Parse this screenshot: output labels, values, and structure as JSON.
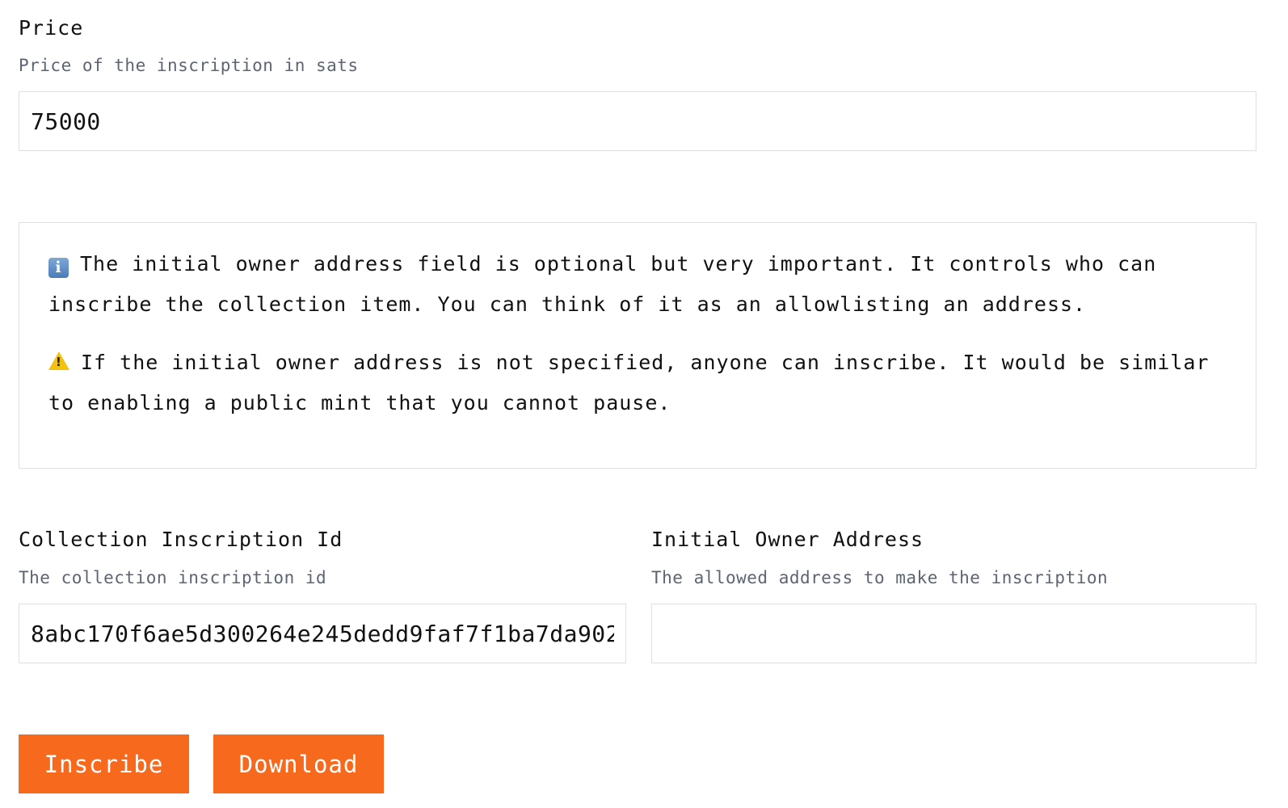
{
  "price": {
    "label": "Price",
    "hint": "Price of the inscription in sats",
    "value": "75000"
  },
  "notice": {
    "info_icon": "information-icon",
    "info_text": "The initial owner address field is optional but very important. It controls who can inscribe the collection item. You can think of it as an allowlisting an address.",
    "warning_icon": "warning-icon",
    "warning_text": "If the initial owner address is not specified, anyone can inscribe. It would be similar to enabling a public mint that you cannot pause."
  },
  "collection_inscription": {
    "label": "Collection Inscription Id",
    "hint": "The collection inscription id",
    "value": "8abc170f6ae5d300264e245dedd9faf7f1ba7da902"
  },
  "initial_owner": {
    "label": "Initial Owner Address",
    "hint": "The allowed address to make the inscription",
    "value": ""
  },
  "buttons": {
    "inscribe": "Inscribe",
    "download": "Download"
  },
  "colors": {
    "accent": "#f7691d",
    "hint_text": "#5d6572",
    "border": "#dcdfe3"
  }
}
